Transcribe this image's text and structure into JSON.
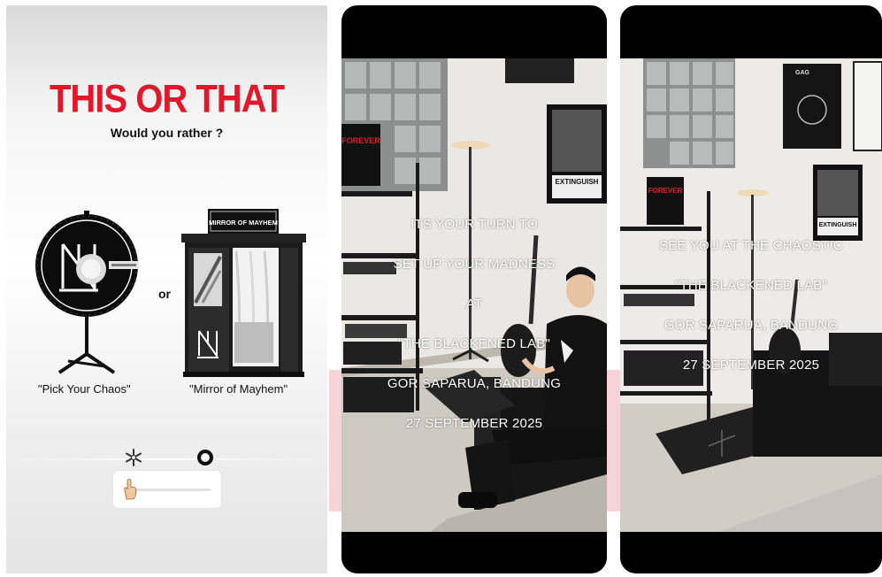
{
  "poll_story": {
    "title": "THIS OR THAT",
    "subtitle": "Would you rather ?",
    "or_label": "or",
    "option_a": {
      "label": "\"Pick Your Chaos\""
    },
    "option_b": {
      "label": "\"Mirror of Mayhem\"",
      "sign_text": "MIRROR OF MAYHEM"
    },
    "slider": {
      "value_fraction": 0.05,
      "emoji_left": "snowflake-icon",
      "emoji_right": "ring-icon"
    }
  },
  "story_2": {
    "lines": [
      "ITS YOUR TURN TO",
      "SET UP YOUR MADNESS",
      "AT",
      "\"THE BLACKENED LAB\"",
      "GOR SAPARUA, BANDUNG",
      "27 SEPTEMBER 2025"
    ],
    "poster_text": "FOREVER",
    "frame_text": "EXTINGUISH"
  },
  "story_3": {
    "lines": [
      "SEE YOU AT THE CHAOSTIC",
      "\"THE BLACKENED LAB\"",
      "GOR SAPARUA, BANDUNG",
      "27 SEPTEMBER 2025"
    ],
    "poster_text": "FOREVER",
    "frame_text": "EXTINGUISH",
    "frame_top_text": "GAG"
  },
  "colors": {
    "title_red": "#e3172a",
    "background_pink": "#f6d3d6",
    "story_black": "#000000",
    "wall": "#ededeb",
    "floor": "#c9c4bb"
  }
}
